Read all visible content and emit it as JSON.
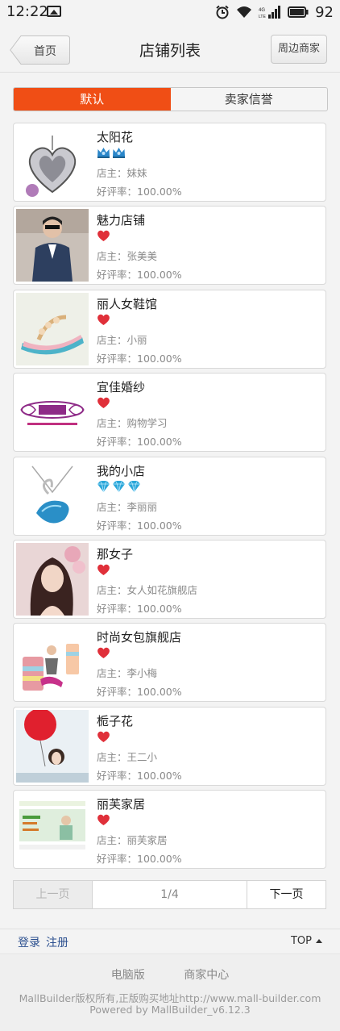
{
  "status_bar": {
    "time": "12:22",
    "network": "4G LTE",
    "battery_percent": "92"
  },
  "header": {
    "back_label": "首页",
    "title": "店铺列表",
    "nearby_label": "周边商家"
  },
  "tabs": [
    {
      "label": "默认",
      "active": true
    },
    {
      "label": "卖家信誉",
      "active": false
    }
  ],
  "stores": [
    {
      "name": "太阳花",
      "badge_type": "crown",
      "badge_count": 2,
      "owner": "店主：妹妹",
      "rating": "好评率：100.00%",
      "thumb": "heart-pendant"
    },
    {
      "name": "魅力店铺",
      "badge_type": "heart",
      "badge_count": 1,
      "owner": "店主：张美美",
      "rating": "好评率：100.00%",
      "thumb": "man-jacket"
    },
    {
      "name": "丽人女鞋馆",
      "badge_type": "heart",
      "badge_count": 1,
      "owner": "店主：小丽",
      "rating": "好评率：100.00%",
      "thumb": "sandal"
    },
    {
      "name": "宜佳婚纱",
      "badge_type": "heart",
      "badge_count": 1,
      "owner": "店主：购物学习",
      "rating": "好评率：100.00%",
      "thumb": "wedding-logo"
    },
    {
      "name": "我的小店",
      "badge_type": "diamond",
      "badge_count": 3,
      "owner": "店主：李丽丽",
      "rating": "好评率：100.00%",
      "thumb": "swan-pendant"
    },
    {
      "name": "那女子",
      "badge_type": "heart",
      "badge_count": 1,
      "owner": "店主：女人如花旗舰店",
      "rating": "好评率：100.00%",
      "thumb": "woman-portrait"
    },
    {
      "name": "时尚女包旗舰店",
      "badge_type": "heart",
      "badge_count": 1,
      "owner": "店主：李小梅",
      "rating": "好评率：100.00%",
      "thumb": "luggage"
    },
    {
      "name": "栀子花",
      "badge_type": "heart",
      "badge_count": 1,
      "owner": "店主：王二小",
      "rating": "好评率：100.00%",
      "thumb": "balloon"
    },
    {
      "name": "丽芙家居",
      "badge_type": "heart",
      "badge_count": 1,
      "owner": "店主：丽芙家居",
      "rating": "好评率：100.00%",
      "thumb": "home-page"
    }
  ],
  "pagination": {
    "prev_label": "上一页",
    "page_info": "1/4",
    "next_label": "下一页"
  },
  "footer": {
    "login": "登录",
    "register": "注册",
    "top": "TOP",
    "desktop_link": "电脑版",
    "merchant_link": "商家中心",
    "copyright": "MallBuilder版权所有,正版购买地址http://www.mall-builder.com",
    "powered_by": "Powered by MallBuilder_v6.12.3"
  },
  "colors": {
    "accent": "#f04e15",
    "link": "#2b4f8f",
    "heart": "#e0303a",
    "diamond": "#2aa6d8",
    "crown": "#2a86c9"
  }
}
